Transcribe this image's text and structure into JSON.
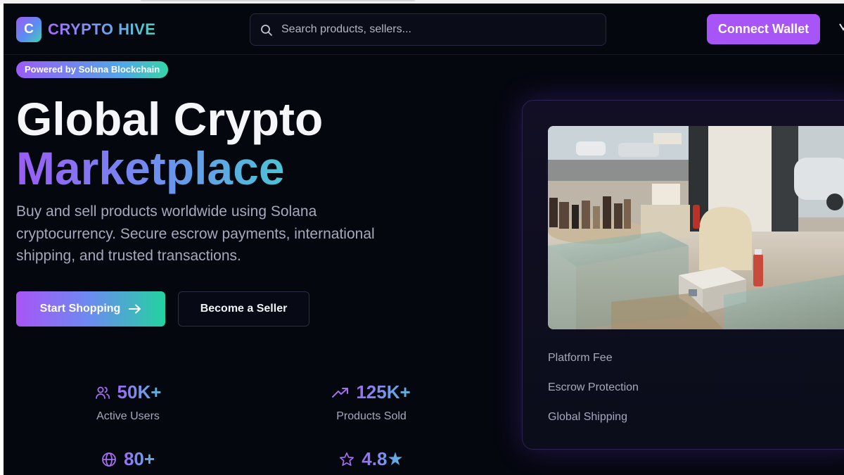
{
  "header": {
    "logo_letter": "C",
    "brand": "CRYPTO HIVE",
    "search_placeholder": "Search products, sellers...",
    "connect_label": "Connect Wallet"
  },
  "hero": {
    "pill": "Powered by Solana Blockchain",
    "title_line1": "Global Crypto",
    "title_line2": "Marketplace",
    "description": "Buy and sell products worldwide using Solana cryptocurrency. Secure escrow payments, international shipping, and trusted transactions.",
    "primary_cta": "Start Shopping",
    "secondary_cta": "Become a Seller"
  },
  "stats": [
    {
      "icon": "users-icon",
      "value": "50K+",
      "label": "Active Users"
    },
    {
      "icon": "trending-up-icon",
      "value": "125K+",
      "label": "Products Sold"
    },
    {
      "icon": "globe-icon",
      "value": "80+",
      "label": ""
    },
    {
      "icon": "star-icon",
      "value": "4.8★",
      "label": ""
    }
  ],
  "card": {
    "features": [
      "Platform Fee",
      "Escrow Protection",
      "Global Shipping"
    ]
  },
  "colors": {
    "background": "#05070f",
    "accent_purple": "#a855f7",
    "accent_green": "#22d3a0"
  }
}
